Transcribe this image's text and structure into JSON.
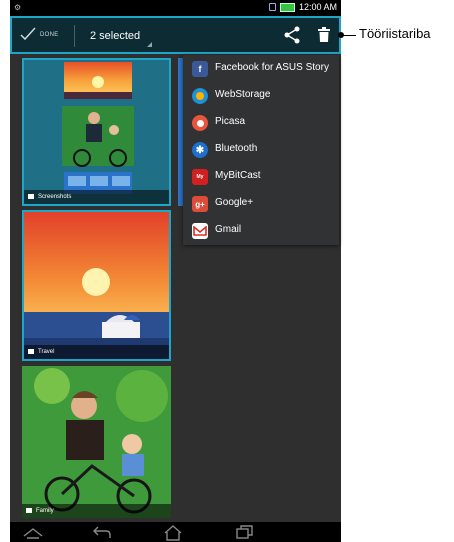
{
  "status_bar": {
    "time": "12:00 AM"
  },
  "action_bar": {
    "done_label": "DONE",
    "selected_label": "2 selected"
  },
  "albums": [
    {
      "label": "Screenshots",
      "selected": true
    },
    {
      "label": "Travel",
      "selected": true
    },
    {
      "label": "Family",
      "selected": false
    }
  ],
  "share_menu": {
    "items": [
      {
        "label": "Facebook for ASUS Story",
        "icon": "facebook-icon",
        "color": "#3b5998"
      },
      {
        "label": "WebStorage",
        "icon": "webstorage-icon",
        "color": "#1e90d6"
      },
      {
        "label": "Picasa",
        "icon": "picasa-icon",
        "color": "#e8543c"
      },
      {
        "label": "Bluetooth",
        "icon": "bluetooth-icon",
        "color": "#1e6fd0"
      },
      {
        "label": "MyBitCast",
        "icon": "mybitcast-icon",
        "color": "#d02020"
      },
      {
        "label": "Google+",
        "icon": "google-plus-icon",
        "color": "#dd4b39"
      },
      {
        "label": "Gmail",
        "icon": "gmail-icon",
        "color": "#ffffff"
      }
    ]
  },
  "callout": {
    "label": "Tööriistariba"
  },
  "colors": {
    "accent": "#1ea6c8",
    "action_bar": "#0c2b33"
  }
}
